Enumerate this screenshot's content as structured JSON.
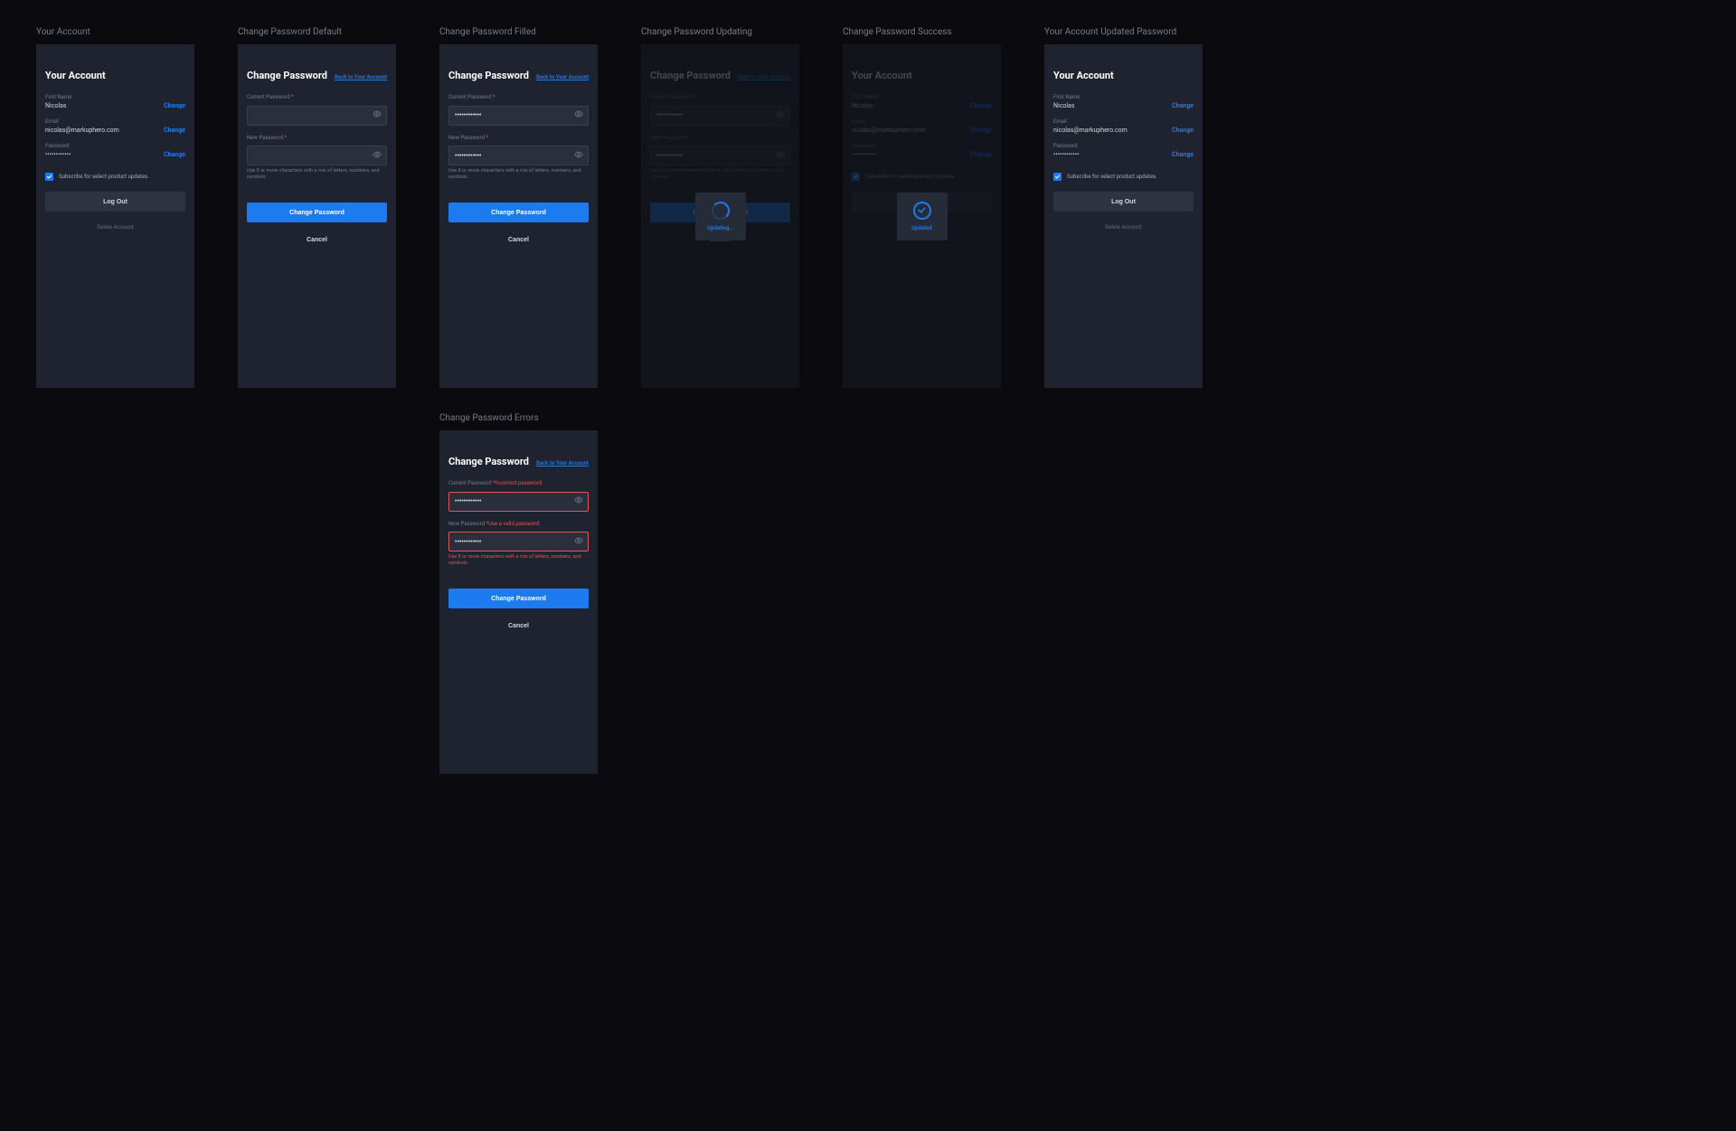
{
  "columns": {
    "account": "Your Account",
    "cp_default": "Change Password Default",
    "cp_filled": "Change Password Filled",
    "cp_updating": "Change Password Updating",
    "cp_success": "Change Password Success",
    "account_updated": "Your Account Updated Password",
    "cp_errors": "Change Password Errors"
  },
  "account": {
    "title": "Your Account",
    "first_name_label": "First Name",
    "first_name_value": "Nicolas",
    "email_label": "Email",
    "email_value": "nicolas@markuphero.com",
    "password_label": "Password",
    "password_mask": "••••••••••••",
    "change": "Change",
    "subscribe": "Subscribe for select product updates.",
    "logout": "Log Out",
    "delete": "Delete Account"
  },
  "cp": {
    "title": "Change Password",
    "back": "Back to Your Account",
    "current_label": "Current Password",
    "new_label": "New Password",
    "req": "*",
    "hint": "Use 8 or more characters with a mix of letters, numbers, and symbols.",
    "submit": "Change Password",
    "cancel": "Cancel",
    "mask": "••••••••••••",
    "err_current": "Incorrect password.",
    "err_new": "Use a valid password."
  },
  "overlay": {
    "updating": "Updating…",
    "updated": "Updated"
  }
}
